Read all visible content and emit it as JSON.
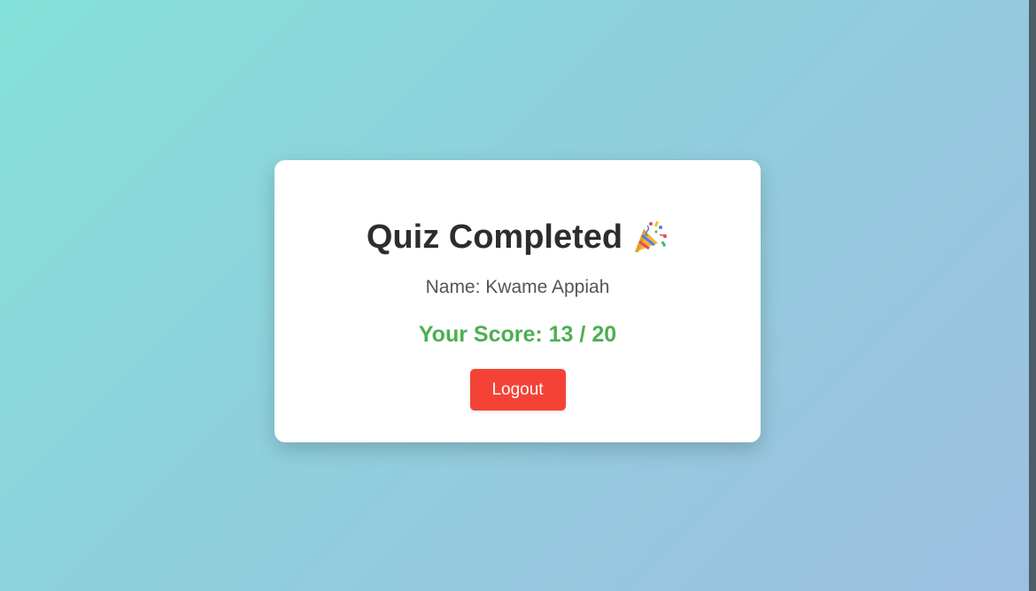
{
  "page": {
    "background_start": "#84e1da",
    "background_end": "#9dbfe0"
  },
  "card": {
    "title": "Quiz Completed",
    "title_icon": "party-popper-icon",
    "name_label": "Name:",
    "name_value": "Kwame Appiah",
    "score_label": "Your Score:",
    "score_value": "13",
    "score_separator": "/",
    "score_total": "20",
    "score_color": "#4caf50",
    "logout_label": "Logout",
    "logout_color": "#f44336"
  }
}
